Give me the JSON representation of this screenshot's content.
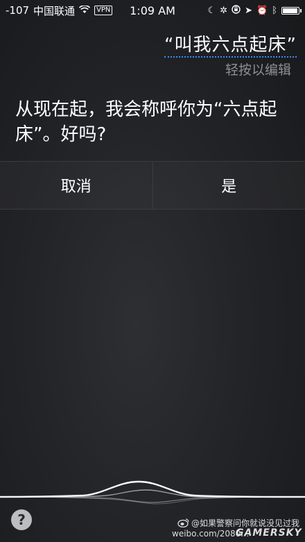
{
  "status_bar": {
    "signal": "-107",
    "carrier": "中国联通",
    "vpn": "VPN",
    "time": "1:09 AM",
    "battery_level": 0.95,
    "icons": [
      "wifi-icon",
      "moon-icon",
      "activity-icon",
      "rotation-lock-icon",
      "location-icon",
      "alarm-icon",
      "bluetooth-icon",
      "battery-icon"
    ]
  },
  "siri": {
    "utterance": "“叫我六点起床”",
    "tap_to_edit": "轻按以编辑",
    "response": "从现在起，我会称呼你为“六点起床”。好吗?",
    "cancel_label": "取消",
    "confirm_label": "是"
  },
  "help_label": "?",
  "watermark": {
    "handle": "@如果警察问你就说没见过我",
    "url": "weibo.com/2080…",
    "brand": "GAMERSKY"
  },
  "colors": {
    "background": "#232428",
    "accent_underline": "#3d8bff",
    "secondary_text": "#8d8f94"
  }
}
